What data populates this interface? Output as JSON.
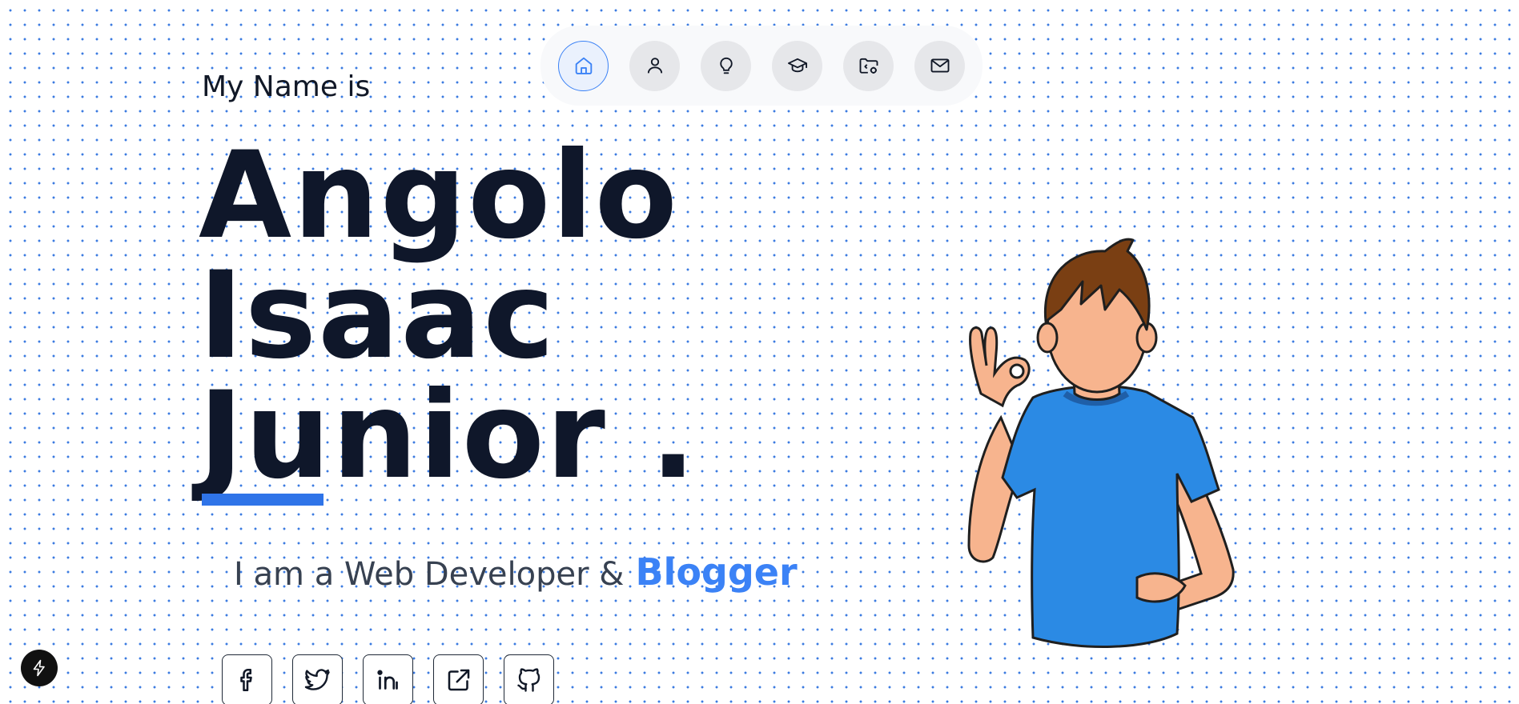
{
  "intro": "My Name is",
  "name": {
    "first": "Angolo",
    "middle": "Isaac",
    "last": "Junior ."
  },
  "tagline": {
    "prefix": "I am a Web Developer &",
    "highlight": "Blogger"
  },
  "nav": {
    "items": [
      {
        "icon": "home-icon",
        "active": true
      },
      {
        "icon": "user-icon",
        "active": false
      },
      {
        "icon": "lightbulb-icon",
        "active": false
      },
      {
        "icon": "graduation-cap-icon",
        "active": false
      },
      {
        "icon": "folder-code-icon",
        "active": false
      },
      {
        "icon": "mail-icon",
        "active": false
      }
    ]
  },
  "socials": [
    "facebook-icon",
    "twitter-icon",
    "linkedin-icon",
    "external-link-icon",
    "github-icon"
  ],
  "colors": {
    "accent": "#3b82f6",
    "underline": "#2f74e8",
    "dots": "#3b7be0",
    "text_dark": "#0f172a",
    "shirt": "#2b8ae4"
  }
}
